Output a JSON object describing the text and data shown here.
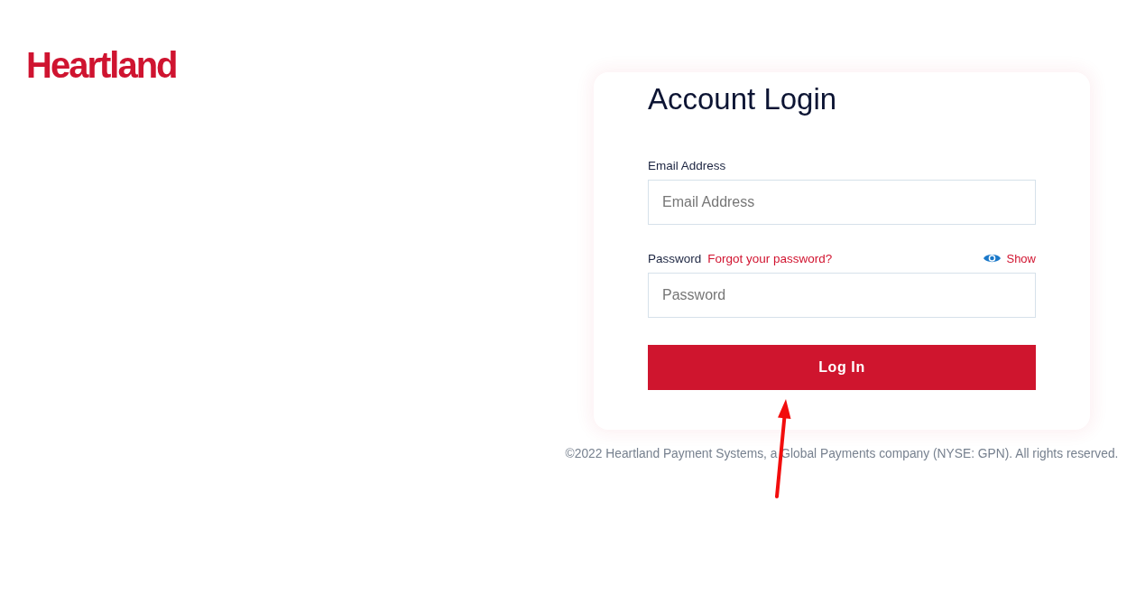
{
  "logo": {
    "text": "Heartland"
  },
  "login": {
    "title": "Account Login",
    "fields": [
      {
        "label": "Email Address",
        "placeholder": "Email Address"
      },
      {
        "label": "Password",
        "link": "Forgot your password?",
        "toggle": "Show",
        "placeholder": "Password"
      }
    ],
    "button": "Log In"
  },
  "footer": "©2022 Heartland Payment Systems, a Global Payments company (NYSE: GPN). All rights reserved."
}
